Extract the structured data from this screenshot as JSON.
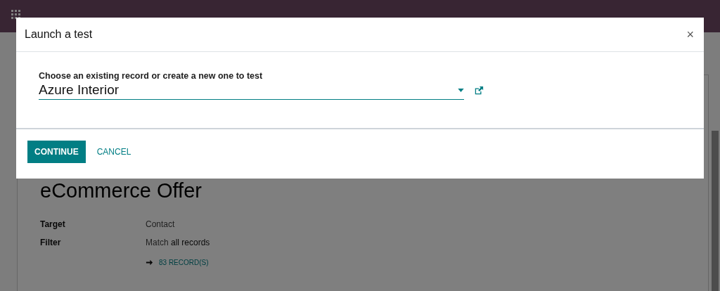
{
  "record": {
    "title": "eCommerce Offer",
    "fields": [
      {
        "label": "Target",
        "value": "Contact"
      },
      {
        "label": "Filter",
        "value": "Match **all records**"
      }
    ],
    "records_link": "83 RECORD(S)"
  },
  "dialog": {
    "title": "Launch a test",
    "close": "×",
    "field_label": "Choose an existing record or create a new one to test",
    "field_value": "Azure Interior",
    "buttons": [
      {
        "label": "CONTINUE",
        "kind": "primary"
      },
      {
        "label": "CANCEL",
        "kind": "link"
      }
    ]
  }
}
